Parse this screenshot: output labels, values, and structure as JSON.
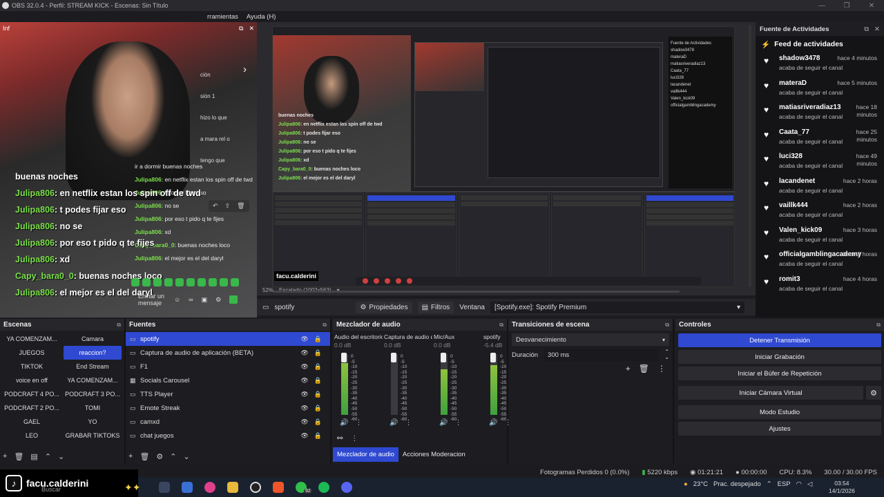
{
  "window": {
    "title": "OBS 32.0.4 - Perfil: STREAM KICK - Escenas: Sin Título"
  },
  "menu": {
    "items": [
      "rramientas",
      "Ayuda (H)"
    ]
  },
  "left_dock": {
    "overlay_lines": [
      "ción",
      "sión 1",
      "hizo lo que",
      "a mara rel o",
      "tengo que"
    ],
    "chat": [
      {
        "user": "",
        "msg": "buenas noches"
      },
      {
        "user": "Julipa806",
        "msg": ": en netflix estan los spin off de twd"
      },
      {
        "user": "Julipa806",
        "msg": ": t podes fijar eso"
      },
      {
        "user": "Julipa806",
        "msg": ": no se"
      },
      {
        "user": "Julipa806",
        "msg": ": por eso t pido q te fijes"
      },
      {
        "user": "Julipa806",
        "msg": ": xd"
      },
      {
        "user": "Capy_bara0_0",
        "msg": ": buenas noches loco"
      },
      {
        "user": "Julipa806",
        "msg": ": el mejor es el del daryl"
      }
    ],
    "chat_small": [
      {
        "user": "",
        "msg": "ir a dormir buenas noches"
      },
      {
        "user": "Julipa806",
        "msg": ": en netflix estan los spin off de twd"
      },
      {
        "user": "Julipa806",
        "msg": ": t podes fijar eso"
      },
      {
        "user": "Julipa806",
        "msg": ": no se"
      },
      {
        "user": "Julipa806",
        "msg": ": por eso t pido q te fijes"
      },
      {
        "user": "Julipa806",
        "msg": ": xd"
      },
      {
        "user": "Capy_bara0_0",
        "msg": ": buenas noches loco"
      },
      {
        "user": "Julipa806",
        "msg": ": el mejor es el del daryl"
      }
    ],
    "send_placeholder": "Enviar un mensaje"
  },
  "preview": {
    "zoom": "52%",
    "scaled": "Escalado (1002x563)",
    "brand": "facu.calderini"
  },
  "feed": {
    "dock_title": "Fuente de Actividades",
    "title": "Feed de actividades",
    "items": [
      {
        "name": "shadow3478",
        "sub": "acaba de seguir el canal",
        "time": "hace 4 minutos"
      },
      {
        "name": "materaD",
        "sub": "acaba de seguir el canal",
        "time": "hace 5 minutos"
      },
      {
        "name": "matiasriveradiaz13",
        "sub": "acaba de seguir el canal",
        "time": "hace 18 minutos"
      },
      {
        "name": "Caata_77",
        "sub": "acaba de seguir el canal",
        "time": "hace 25 minutos"
      },
      {
        "name": "luci328",
        "sub": "acaba de seguir el canal",
        "time": "hace 49 minutos"
      },
      {
        "name": "lacandenet",
        "sub": "acaba de seguir el canal",
        "time": "hace 2 horas"
      },
      {
        "name": "vaillk444",
        "sub": "acaba de seguir el canal",
        "time": "hace 2 horas"
      },
      {
        "name": "Valen_kick09",
        "sub": "acaba de seguir el canal",
        "time": "hace 3 horas"
      },
      {
        "name": "officialgamblingacademy",
        "sub": "acaba de seguir el canal",
        "time": "hace 3 horas"
      },
      {
        "name": "romit3",
        "sub": "acaba de seguir el canal",
        "time": "hace 4 horas"
      }
    ]
  },
  "source_bar": {
    "source": "spotify",
    "props": "Propiedades",
    "filters": "Filtros",
    "window_label": "Ventana",
    "window_value": "[Spotify.exe]: Spotify Premium"
  },
  "scenes": {
    "title": "Escenas",
    "items": [
      "YA COMENZAM...",
      "Camara",
      "JUEGOS",
      "reaccion?",
      "TIKTOK",
      "End Stream",
      "voice en off",
      "YA COMENZAM...",
      "PODCRAFT 4 PO...",
      "PODCRAFT 3 PO...",
      "PODCRAFT 2 PO...",
      "TOMI",
      "GAEL",
      "YO",
      "LEO",
      "GRABAR TIKTOKS"
    ],
    "active_index": 3
  },
  "sources": {
    "title": "Fuentes",
    "items": [
      "spotify",
      "Captura de audio de aplicación (BETA)",
      "F1",
      "Socials Carousel",
      "TTS Player",
      "Emote Streak",
      "camxd",
      "chat juegos"
    ]
  },
  "mixer": {
    "title": "Mezclador de audio",
    "channels": [
      {
        "name": "Audio del escritorio",
        "db": "0.0 dB",
        "level": 0.85
      },
      {
        "name": "Captura de audio d",
        "db": "0.0 dB",
        "level": 0.0
      },
      {
        "name": "Mic/Aux",
        "db": "0.0 dB",
        "level": 0.75
      },
      {
        "name": "spotify",
        "db": "-5.4 dB",
        "level": 0.82
      }
    ],
    "scale": [
      "0",
      "-5",
      "-10",
      "-15",
      "-20",
      "-25",
      "-30",
      "-35",
      "-40",
      "-45",
      "-50",
      "-55",
      "-60"
    ],
    "tab_active": "Mezclador de audio",
    "tab_other": "Acciones Moderacion"
  },
  "transitions": {
    "title": "Transiciones de escena",
    "selected": "Desvanecimiento",
    "duration_label": "Duración",
    "duration_value": "300 ms"
  },
  "controls": {
    "title": "Controles",
    "buttons": [
      "Detener Transmisión",
      "Iniciar Grabación",
      "Iniciar el Búfer de Repetición",
      "Iniciar Cámara Virtual",
      "Modo Estudio",
      "Ajustes"
    ]
  },
  "status": {
    "dropped": "Fotogramas Perdidos 0 (0.0%)",
    "bitrate": "5220 kbps",
    "live_time": "01:21:21",
    "rec_time": "00:00:00",
    "cpu": "CPU: 8.3%",
    "fps": "30.00 / 30.00 FPS"
  },
  "taskbar": {
    "brand": "facu.calderini",
    "search": "Buscar",
    "badge": "92",
    "weather": "23°C",
    "weather_desc": "Prac. despejado",
    "lang": "ESP",
    "time": "03:54",
    "date": "14/1/2026"
  },
  "colors": {
    "accent": "#2f49d1",
    "chat_user": "#7be04b"
  }
}
